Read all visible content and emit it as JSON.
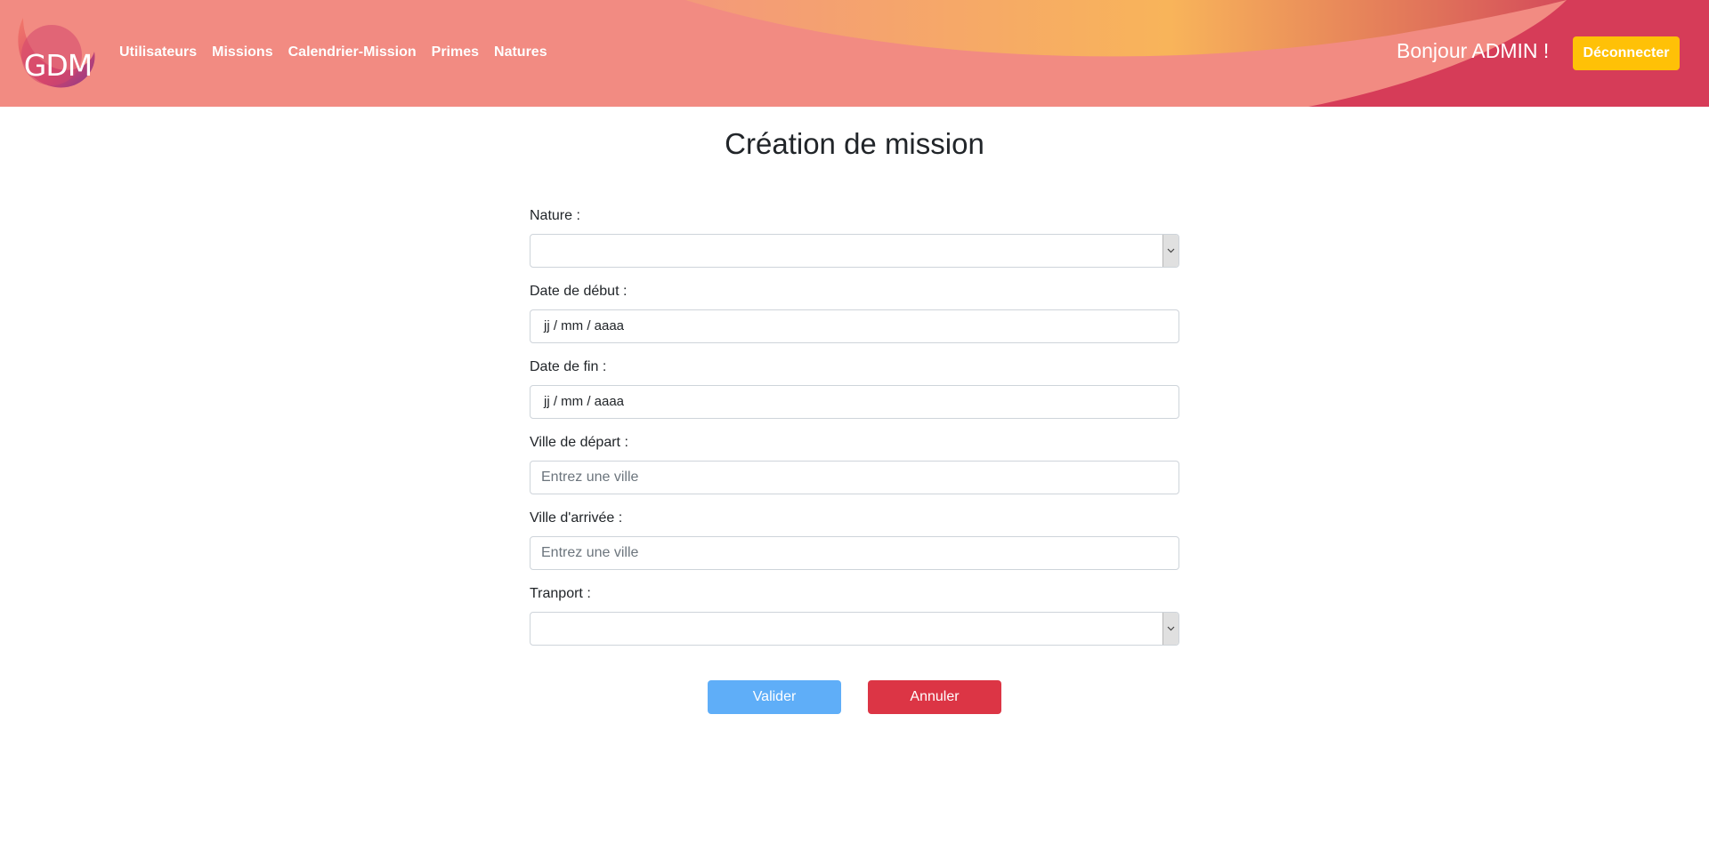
{
  "app": {
    "logo_text": "GDM"
  },
  "nav": {
    "items": [
      {
        "label": "Utilisateurs"
      },
      {
        "label": "Missions"
      },
      {
        "label": "Calendrier-Mission"
      },
      {
        "label": "Primes"
      },
      {
        "label": "Natures"
      }
    ]
  },
  "header": {
    "greeting": "Bonjour ADMIN !",
    "logout_label": "Déconnecter"
  },
  "page": {
    "title": "Création de mission"
  },
  "form": {
    "nature": {
      "label": "Nature :",
      "value": ""
    },
    "start_date": {
      "label": "Date de début :",
      "value": "jj / mm / aaaa"
    },
    "end_date": {
      "label": "Date de fin :",
      "value": "jj / mm / aaaa"
    },
    "departure_city": {
      "label": "Ville de départ :",
      "placeholder": "Entrez une ville"
    },
    "arrival_city": {
      "label": "Ville d'arrivée :",
      "placeholder": "Entrez une ville"
    },
    "transport": {
      "label": "Tranport :",
      "value": ""
    },
    "submit_label": "Valider",
    "cancel_label": "Annuler"
  },
  "colors": {
    "header_pink": "#f28b82",
    "header_orange": "#f7b05a",
    "header_red": "#d63c58",
    "logout": "#ffc107",
    "primary": "#5faef8",
    "danger": "#dc3545"
  }
}
